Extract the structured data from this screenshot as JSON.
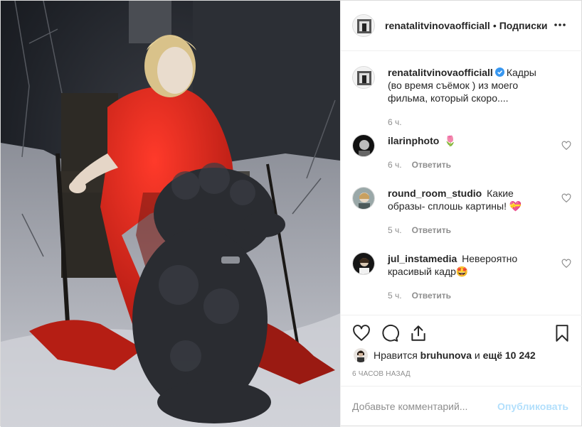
{
  "post": {
    "author": "renatalitvinovaofficiall",
    "follow_label": "Подписки",
    "separator": "•",
    "more_icon": "more-horizontal-icon",
    "photo_icon": "post-photo"
  },
  "caption": {
    "user": "renatalitvinovaofficiall",
    "text": "Кадры (во время съёмок ) из моего фильма, который скоро....",
    "time": "6 ч."
  },
  "comments": [
    {
      "user": "ilarinphoto",
      "text": "🌷",
      "time": "6 ч.",
      "reply": "Ответить"
    },
    {
      "user": "round_room_studio",
      "text": "Какие образы- сплошь картины! 💝",
      "time": "5 ч.",
      "reply": "Ответить"
    },
    {
      "user": "jul_instamedia",
      "text": "Невероятно красивый кадр🤩",
      "time": "5 ч.",
      "reply": "Ответить"
    }
  ],
  "actions": {
    "like_icon": "heart-icon",
    "comment_icon": "comment-icon",
    "share_icon": "share-icon",
    "save_icon": "bookmark-icon"
  },
  "likes": {
    "prefix": "Нравится",
    "user": "bruhunova",
    "middle": "и",
    "others": "ещё 10 242"
  },
  "timestamp": "6 ЧАСОВ НАЗАД",
  "add_comment": {
    "placeholder": "Добавьте комментарий...",
    "publish": "Опубликовать"
  },
  "colors": {
    "accent_disabled": "#b2dffc",
    "verified": "#3897f0",
    "muted": "#8e8e8e",
    "text": "#262626",
    "red_coat": "#d42418"
  }
}
